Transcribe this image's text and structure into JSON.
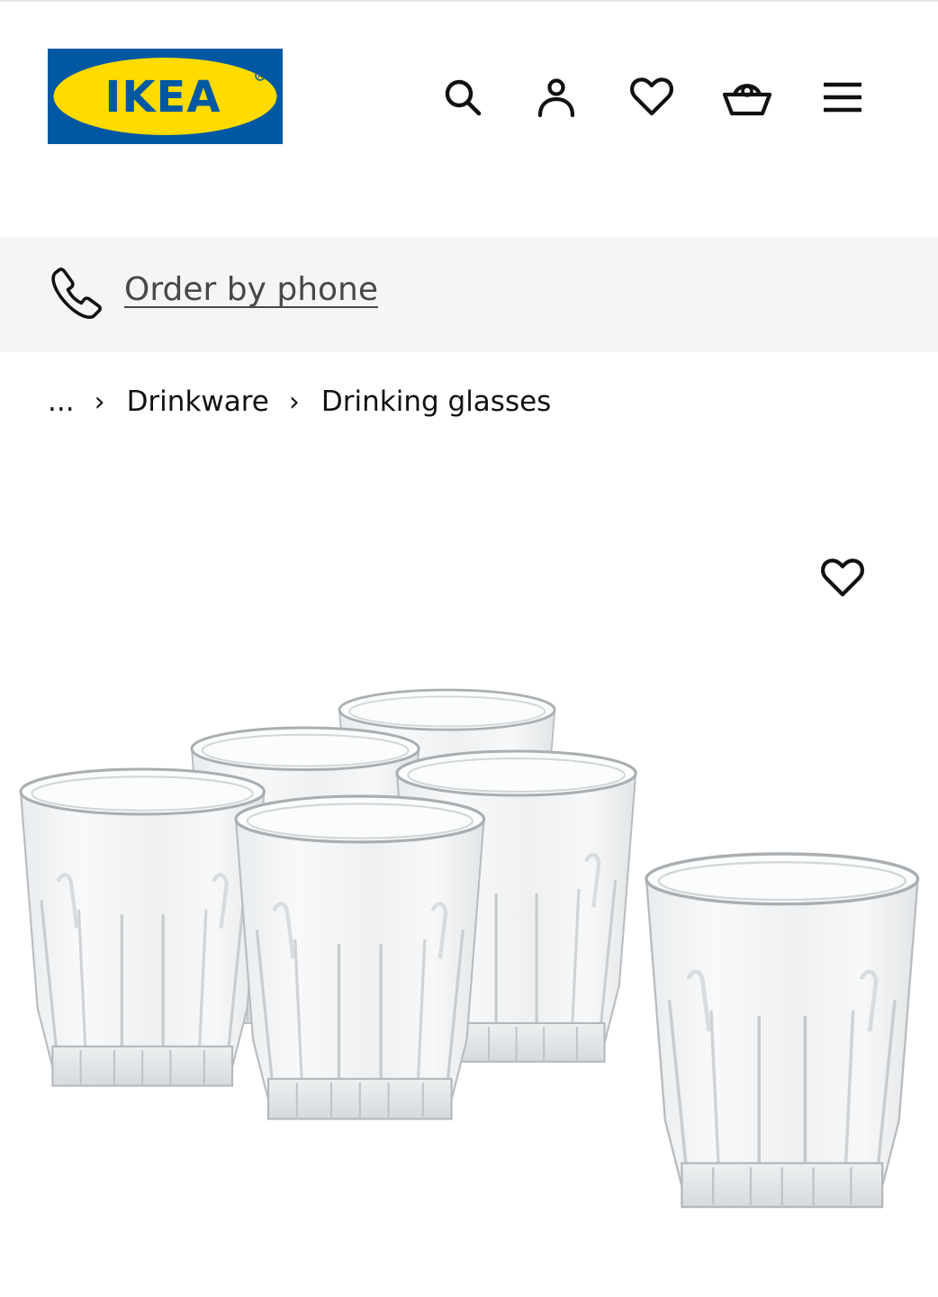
{
  "brand": {
    "logo_text": "IKEA",
    "colors": {
      "logo_blue": "#0058a3",
      "logo_yellow": "#ffdb00"
    }
  },
  "header": {
    "icons": [
      {
        "name": "search-icon"
      },
      {
        "name": "account-icon"
      },
      {
        "name": "favourites-icon"
      },
      {
        "name": "shopping-basket-icon"
      },
      {
        "name": "hamburger-menu-icon"
      }
    ]
  },
  "phone_band": {
    "icon": "phone-icon",
    "link_label": "Order by phone"
  },
  "breadcrumb": {
    "ellipsis": "...",
    "separator": "›",
    "items": [
      "Drinkware",
      "Drinking glasses"
    ]
  },
  "product": {
    "favourite_icon": "heart-outline-icon",
    "image_subject": "clear-glass-tumblers"
  }
}
